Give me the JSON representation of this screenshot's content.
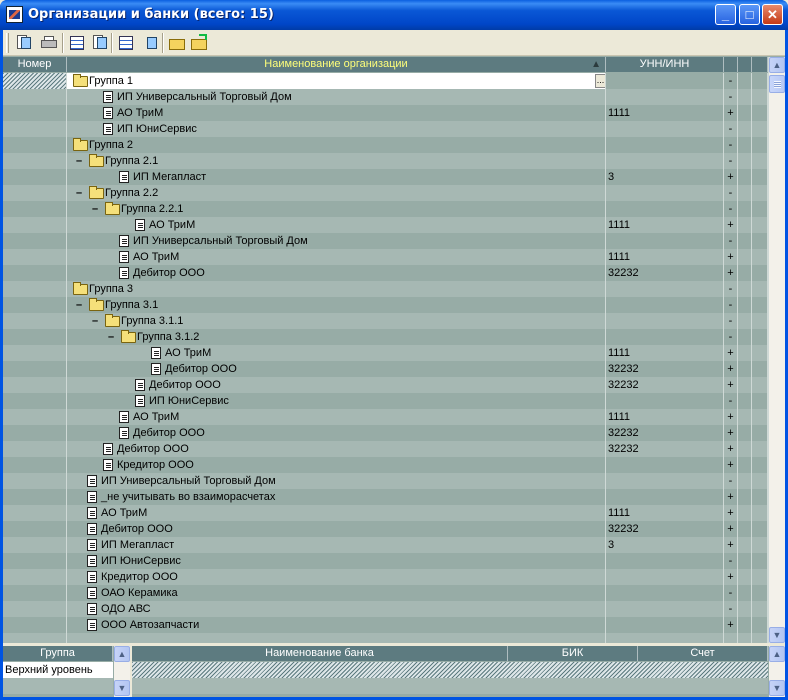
{
  "window": {
    "title": "Организации и банки (всего: 15)",
    "buttons": {
      "minimize": "_",
      "maximize": "□",
      "close": "✕"
    }
  },
  "toolbar": {
    "buttons": [
      "open-card-icon",
      "print-icon",
      "edit-icon",
      "copy-icon",
      "tree-icon",
      "export-icon",
      "folder-open-icon",
      "folder-up-icon"
    ]
  },
  "grid": {
    "columns": {
      "number": "Номер",
      "name": "Наименование организации",
      "unn": "УНН/ИНН"
    },
    "rows": [
      {
        "level": 0,
        "type": "folder",
        "dash": false,
        "name": "Группа 1",
        "unn": "",
        "flag": "-",
        "selected": true
      },
      {
        "level": 1,
        "type": "doc",
        "dash": false,
        "name": "ИП Универсальный Торговый Дом",
        "unn": "",
        "flag": "-"
      },
      {
        "level": 1,
        "type": "doc",
        "dash": false,
        "name": "АО ТриМ",
        "unn": "1111",
        "flag": "+"
      },
      {
        "level": 1,
        "type": "doc",
        "dash": false,
        "name": "ИП ЮниСервис",
        "unn": "",
        "flag": "-"
      },
      {
        "level": 0,
        "type": "folder",
        "dash": false,
        "name": "Группа 2",
        "unn": "",
        "flag": "-"
      },
      {
        "level": 1,
        "type": "folder",
        "dash": true,
        "name": "Группа 2.1",
        "unn": "",
        "flag": "-"
      },
      {
        "level": 2,
        "type": "doc",
        "dash": false,
        "name": "ИП Мегапласт",
        "unn": "3",
        "flag": "+"
      },
      {
        "level": 1,
        "type": "folder",
        "dash": true,
        "name": "Группа 2.2",
        "unn": "",
        "flag": "-"
      },
      {
        "level": 2,
        "type": "folder",
        "dash": true,
        "name": "Группа 2.2.1",
        "unn": "",
        "flag": "-"
      },
      {
        "level": 3,
        "type": "doc",
        "dash": false,
        "name": "АО ТриМ",
        "unn": "1111",
        "flag": "+"
      },
      {
        "level": 2,
        "type": "doc",
        "dash": false,
        "name": "ИП Универсальный Торговый Дом",
        "unn": "",
        "flag": "-"
      },
      {
        "level": 2,
        "type": "doc",
        "dash": false,
        "name": "АО ТриМ",
        "unn": "1111",
        "flag": "+"
      },
      {
        "level": 2,
        "type": "doc",
        "dash": false,
        "name": "Дебитор ООО",
        "unn": "32232",
        "flag": "+"
      },
      {
        "level": 0,
        "type": "folder",
        "dash": false,
        "name": "Группа 3",
        "unn": "",
        "flag": "-"
      },
      {
        "level": 1,
        "type": "folder",
        "dash": true,
        "name": "Группа 3.1",
        "unn": "",
        "flag": "-"
      },
      {
        "level": 2,
        "type": "folder",
        "dash": true,
        "name": "Группа 3.1.1",
        "unn": "",
        "flag": "-"
      },
      {
        "level": 3,
        "type": "folder",
        "dash": true,
        "name": "Группа 3.1.2",
        "unn": "",
        "flag": "-"
      },
      {
        "level": 4,
        "type": "doc",
        "dash": false,
        "name": "АО ТриМ",
        "unn": "1111",
        "flag": "+"
      },
      {
        "level": 4,
        "type": "doc",
        "dash": false,
        "name": "Дебитор ООО",
        "unn": "32232",
        "flag": "+"
      },
      {
        "level": 3,
        "type": "doc",
        "dash": false,
        "name": "Дебитор ООО",
        "unn": "32232",
        "flag": "+"
      },
      {
        "level": 3,
        "type": "doc",
        "dash": false,
        "name": "ИП ЮниСервис",
        "unn": "",
        "flag": "-"
      },
      {
        "level": 2,
        "type": "doc",
        "dash": false,
        "name": "АО ТриМ",
        "unn": "1111",
        "flag": "+"
      },
      {
        "level": 2,
        "type": "doc",
        "dash": false,
        "name": "Дебитор ООО",
        "unn": "32232",
        "flag": "+"
      },
      {
        "level": 1,
        "type": "doc",
        "dash": false,
        "name": "Дебитор ООО",
        "unn": "32232",
        "flag": "+"
      },
      {
        "level": 1,
        "type": "doc",
        "dash": false,
        "name": "Кредитор ООО",
        "unn": "",
        "flag": "+"
      },
      {
        "level": 0,
        "type": "doc",
        "dash": false,
        "name": "ИП Универсальный Торговый Дом",
        "unn": "",
        "flag": "-"
      },
      {
        "level": 0,
        "type": "doc",
        "dash": false,
        "name": "_не учитывать во взаиморасчетах",
        "unn": "",
        "flag": "+"
      },
      {
        "level": 0,
        "type": "doc",
        "dash": false,
        "name": "АО ТриМ",
        "unn": "1111",
        "flag": "+"
      },
      {
        "level": 0,
        "type": "doc",
        "dash": false,
        "name": "Дебитор ООО",
        "unn": "32232",
        "flag": "+"
      },
      {
        "level": 0,
        "type": "doc",
        "dash": false,
        "name": "ИП Мегапласт",
        "unn": "3",
        "flag": "+"
      },
      {
        "level": 0,
        "type": "doc",
        "dash": false,
        "name": "ИП ЮниСервис",
        "unn": "",
        "flag": "-"
      },
      {
        "level": 0,
        "type": "doc",
        "dash": false,
        "name": "Кредитор ООО",
        "unn": "",
        "flag": "+"
      },
      {
        "level": 0,
        "type": "doc",
        "dash": false,
        "name": "ОАО Керамика",
        "unn": "",
        "flag": "-"
      },
      {
        "level": 0,
        "type": "doc",
        "dash": false,
        "name": "ОДО АВС",
        "unn": "",
        "flag": "-"
      },
      {
        "level": 0,
        "type": "doc",
        "dash": false,
        "name": "ООО Автозапчасти",
        "unn": "",
        "flag": "+"
      }
    ]
  },
  "groups_panel": {
    "header": "Группа",
    "items": [
      "Верхний уровень"
    ]
  },
  "banks_panel": {
    "columns": {
      "name": "Наименование банка",
      "bik": "БИК",
      "account": "Счет"
    }
  }
}
